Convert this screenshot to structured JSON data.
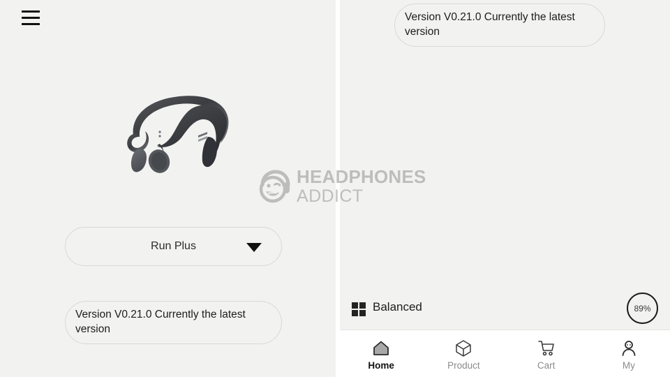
{
  "app": {
    "background_color": "#f2f2f1",
    "accent_color": "#111111",
    "muted_color": "#8b8b8b"
  },
  "left_panel": {
    "menu_icon": "hamburger-menu-icon",
    "product_image_alt": "bone-conduction-headphones",
    "device_select": {
      "label": "Run Plus",
      "caret_icon": "chevron-down-icon"
    },
    "version_notice": "Version V0.21.0 Currently the latest version"
  },
  "right_panel": {
    "version_notice": "Version V0.21.0 Currently the latest version",
    "eq_row": {
      "icon": "grid-2x2-icon",
      "label": "Balanced"
    },
    "battery": {
      "value": "89%"
    },
    "bottom_nav": {
      "items": [
        {
          "label": "Home",
          "icon": "home-icon",
          "active": true
        },
        {
          "label": "Product",
          "icon": "box-icon",
          "active": false
        },
        {
          "label": "Cart",
          "icon": "cart-icon",
          "active": false
        },
        {
          "label": "My",
          "icon": "person-icon",
          "active": false
        }
      ]
    }
  },
  "watermark": {
    "line1": "HEADPHONES",
    "line2": "ADDICT",
    "logo_icon": "smiley-headphones-logo-icon",
    "color": "#9e9e9e"
  }
}
